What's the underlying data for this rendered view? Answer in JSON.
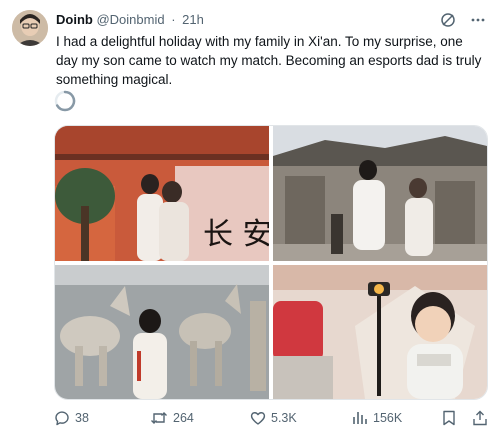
{
  "tweet": {
    "author_name": "Doinb",
    "author_handle": "@Doinbmid",
    "separator": "·",
    "time": "21h",
    "text": "I had a delightful holiday with my family in Xi'an. To my surprise, one day my son came to watch my match. Becoming an esports dad is truly something magical."
  },
  "media": {
    "photos": [
      {
        "label": "couple-at-red-wall"
      },
      {
        "label": "couple-at-city-gate"
      },
      {
        "label": "terracotta-warriors-museum"
      },
      {
        "label": "child-with-lamp"
      }
    ],
    "sign_text": "长 安"
  },
  "actions": {
    "replies": "38",
    "retweets": "264",
    "likes": "5.3K",
    "views": "156K"
  },
  "colors": {
    "text_primary": "#0f1419",
    "text_secondary": "#536471",
    "border": "#e1e5e8"
  }
}
